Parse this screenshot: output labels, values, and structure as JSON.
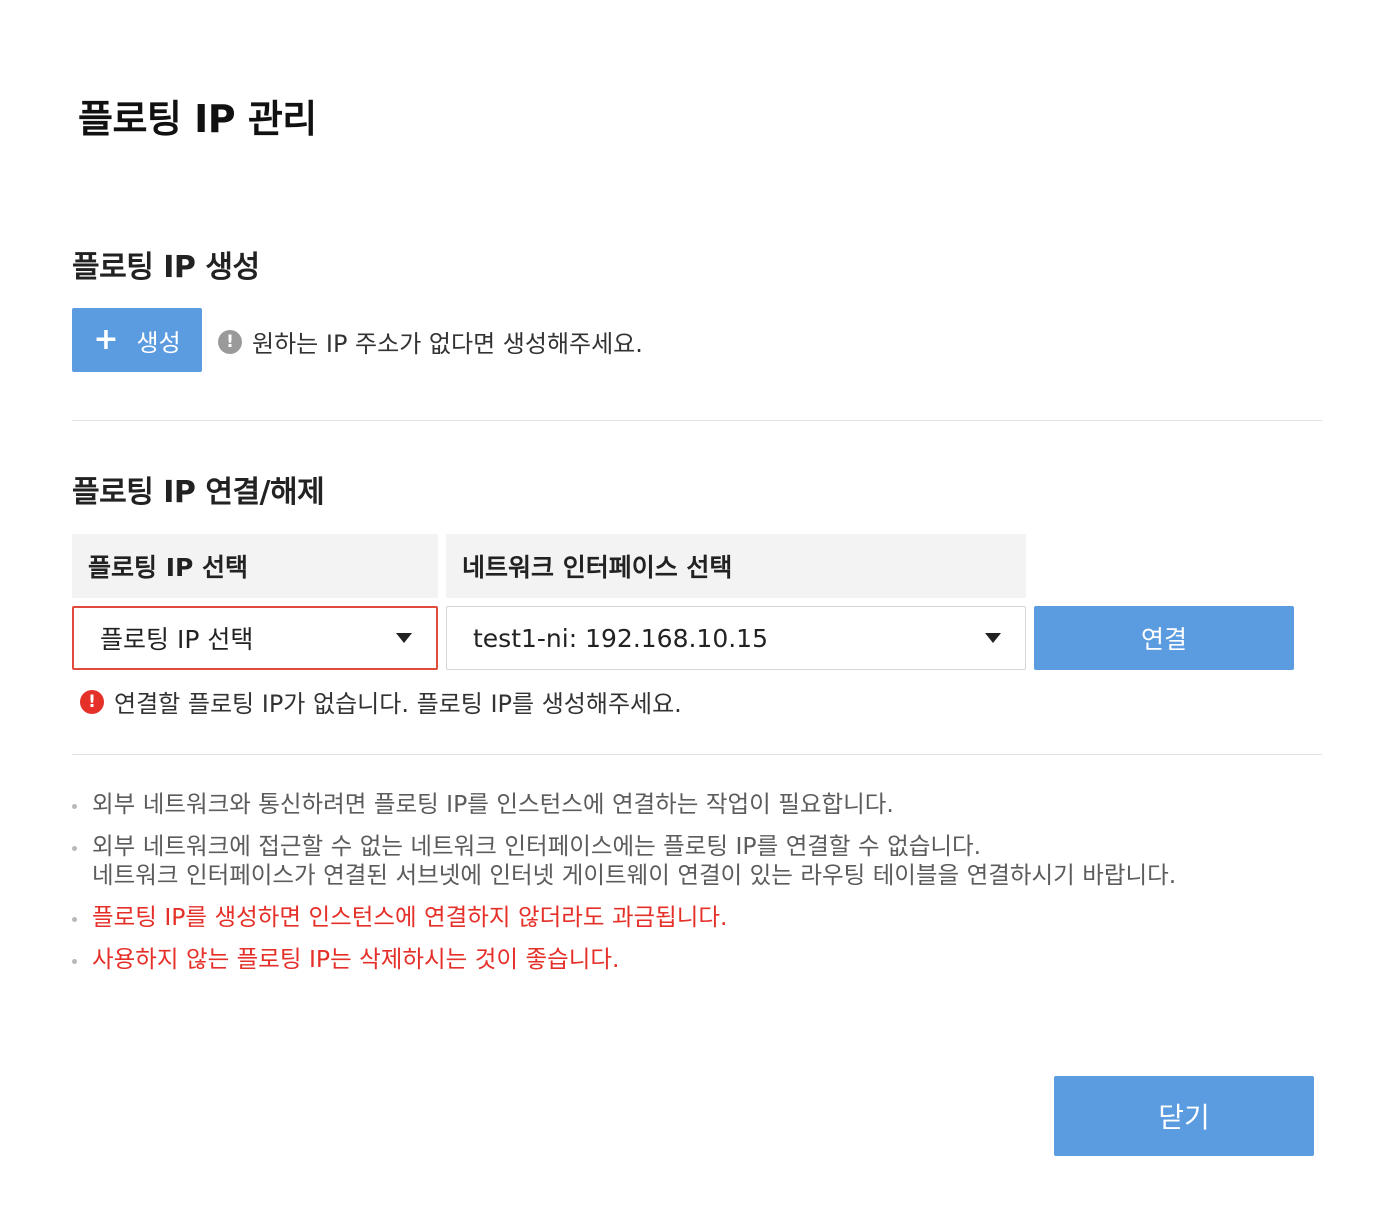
{
  "dialog": {
    "title": "플로팅 IP 관리"
  },
  "create_section": {
    "title": "플로팅 IP 생성",
    "create_button_icon": "+",
    "create_button_label": "생성",
    "hint_icon": "!",
    "hint_text": "원하는 IP 주소가 없다면 생성해주세요."
  },
  "connect_section": {
    "title": "플로팅 IP 연결/해제",
    "floating_ip_header": "플로팅 IP 선택",
    "network_interface_header": "네트워크 인터페이스 선택",
    "floating_ip_select_value": "플로팅 IP 선택",
    "network_interface_select_value": "test1-ni: 192.168.10.15",
    "connect_button_label": "연결",
    "error_icon": "!",
    "error_text": "연결할 플로팅 IP가 없습니다. 플로팅 IP를 생성해주세요."
  },
  "notes": {
    "note1": "외부 네트워크와 통신하려면 플로팅 IP를 인스턴스에 연결하는 작업이 필요합니다.",
    "note2_line1": "외부 네트워크에 접근할 수 없는 네트워크 인터페이스에는 플로팅 IP를 연결할 수 없습니다.",
    "note2_line2": "네트워크 인터페이스가 연결된 서브넷에 인터넷 게이트웨이 연결이 있는 라우팅 테이블을 연결하시기 바랍니다.",
    "note3": "플로팅 IP를 생성하면 인스턴스에 연결하지 않더라도 과금됩니다.",
    "note4": "사용하지 않는 플로팅 IP는 삭제하시는 것이 좋습니다."
  },
  "footer": {
    "close_button_label": "닫기"
  },
  "colors": {
    "primary": "#5b9be0",
    "error": "#e5302a",
    "error_border": "#e14b3c",
    "header_bg": "#f3f3f3",
    "info_icon": "#9a9a9a"
  }
}
